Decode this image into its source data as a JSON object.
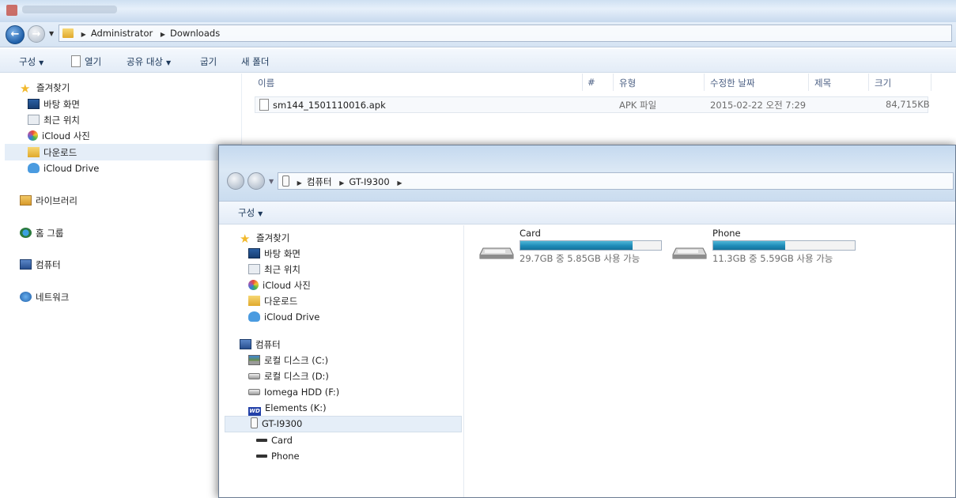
{
  "back_window": {
    "breadcrumb": [
      "Administrator",
      "Downloads"
    ],
    "toolbar": {
      "organize": "구성",
      "open": "열기",
      "share": "공유 대상",
      "burn": "굽기",
      "new_folder": "새 폴더"
    },
    "nav": {
      "favorites": "즐겨찾기",
      "desktop": "바탕 화면",
      "recent": "최근 위치",
      "icloud_photos": "iCloud 사진",
      "downloads": "다운로드",
      "icloud_drive": "iCloud Drive",
      "libraries": "라이브러리",
      "homegroup": "홈 그룹",
      "computer": "컴퓨터",
      "network": "네트워크"
    },
    "columns": {
      "name": "이름",
      "number": "#",
      "type": "유형",
      "modified": "수정한 날짜",
      "title": "제목",
      "size": "크기"
    },
    "files": [
      {
        "name": "sm144_1501110016.apk",
        "type": "APK 파일",
        "modified": "2015-02-22 오전 7:29",
        "size": "84,715KB"
      }
    ]
  },
  "front_window": {
    "breadcrumb": [
      "컴퓨터",
      "GT-I9300"
    ],
    "toolbar": {
      "organize": "구성"
    },
    "nav": {
      "favorites": "즐겨찾기",
      "desktop": "바탕 화면",
      "recent": "최근 위치",
      "icloud_photos": "iCloud 사진",
      "downloads": "다운로드",
      "icloud_drive": "iCloud Drive",
      "computer": "컴퓨터",
      "local_c": "로컬 디스크 (C:)",
      "local_d": "로컬 디스크 (D:)",
      "iomega": "Iomega HDD (F:)",
      "elements": "Elements (K:)",
      "device": "GT-I9300",
      "card": "Card",
      "phone": "Phone"
    },
    "devices": [
      {
        "name": "Card",
        "free_text": "29.7GB 중 5.85GB 사용 가능",
        "used_fraction": 0.8
      },
      {
        "name": "Phone",
        "free_text": "11.3GB 중 5.59GB 사용 가능",
        "used_fraction": 0.51
      }
    ]
  },
  "colors": {
    "usage_bar": "#1e8bb8",
    "selection": "#e5eef8",
    "toolbar_text": "#1e395b",
    "header_text": "#4d6185"
  }
}
